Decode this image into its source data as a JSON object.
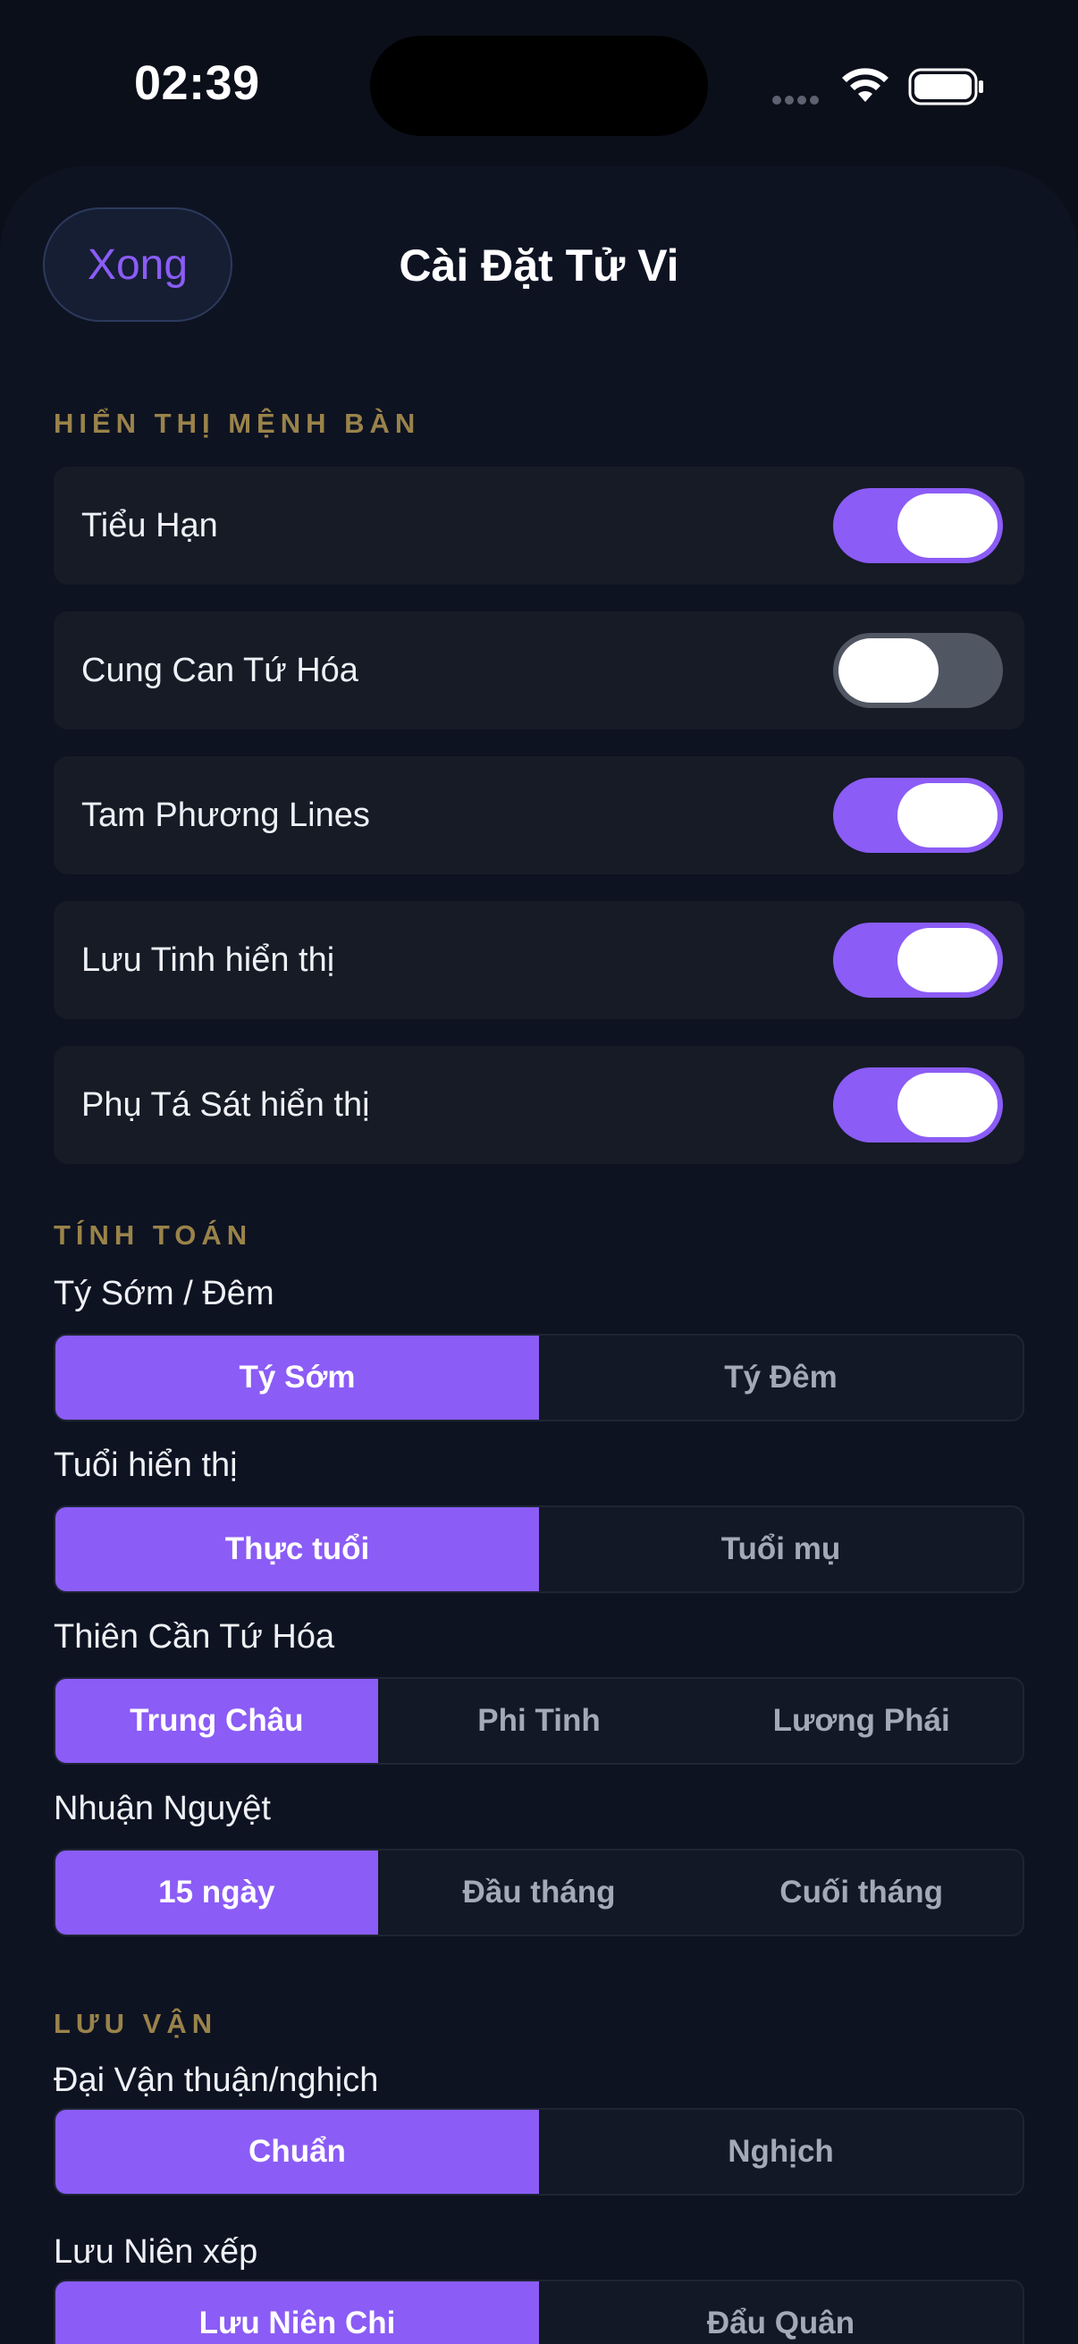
{
  "status_bar": {
    "time": "02:39"
  },
  "header": {
    "done_label": "Xong",
    "title": "Cài Đặt Tử Vi"
  },
  "colors": {
    "accent": "#8b5cf6",
    "section_header": "#9a834a",
    "background": "#0e1322",
    "row_background": "#161b26"
  },
  "sections": {
    "display": {
      "header": "HIỂN THỊ MỆNH BÀN",
      "toggles": [
        {
          "label": "Tiểu Hạn",
          "on": true
        },
        {
          "label": "Cung Can Tứ Hóa",
          "on": false
        },
        {
          "label": "Tam Phương Lines",
          "on": true
        },
        {
          "label": "Lưu Tinh hiển thị",
          "on": true
        },
        {
          "label": "Phụ Tá Sát hiển thị",
          "on": true
        }
      ]
    },
    "calculation": {
      "header": "TÍNH TOÁN",
      "groups": [
        {
          "label": "Tý Sớm / Đêm",
          "options": [
            "Tý Sớm",
            "Tý Đêm"
          ],
          "selected": "Tý Sớm"
        },
        {
          "label": "Tuổi hiển thị",
          "options": [
            "Thực tuổi",
            "Tuổi mụ"
          ],
          "selected": "Thực tuổi"
        },
        {
          "label": "Thiên Cần Tứ Hóa",
          "options": [
            "Trung Châu",
            "Phi Tinh",
            "Lương Phái"
          ],
          "selected": "Trung Châu"
        },
        {
          "label": "Nhuận Nguyệt",
          "options": [
            "15 ngày",
            "Đầu tháng",
            "Cuối tháng"
          ],
          "selected": "15 ngày"
        }
      ]
    },
    "luu_van": {
      "header": "LƯU VẬN",
      "groups": [
        {
          "label": "Đại Vận thuận/nghịch",
          "options": [
            "Chuẩn",
            "Nghịch"
          ],
          "selected": "Chuẩn"
        },
        {
          "label": "Lưu Niên xếp",
          "options": [
            "Lưu Niên Chi",
            "Đẩu Quân"
          ],
          "selected": "Lưu Niên Chi"
        }
      ]
    }
  }
}
